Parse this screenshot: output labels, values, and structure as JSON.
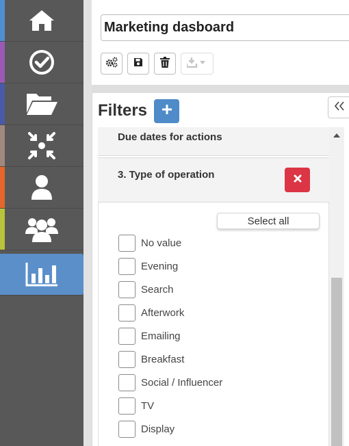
{
  "sidebar": {
    "items": [
      {
        "name": "home",
        "icon": "home-icon",
        "stripe_color": "#4f8fd0"
      },
      {
        "name": "actions",
        "icon": "check-circle-icon",
        "stripe_color": "#9b59b6"
      },
      {
        "name": "files",
        "icon": "folder-open-icon",
        "stripe_color": "#4a5aa8"
      },
      {
        "name": "compress",
        "icon": "compress-icon",
        "stripe_color": "#a1887f"
      },
      {
        "name": "user",
        "icon": "user-icon",
        "stripe_color": "#e5662a"
      },
      {
        "name": "users",
        "icon": "users-icon",
        "stripe_color": "#b8c43a"
      },
      {
        "name": "dashboard",
        "icon": "bar-chart-icon",
        "stripe_color": "#5b8fc9",
        "active": true
      }
    ],
    "active_color": "#5b8fc9"
  },
  "dashboard": {
    "title_value": "Marketing dasboard",
    "toolbar": {
      "settings_icon": "cogs-icon",
      "save_icon": "save-icon",
      "delete_icon": "trash-icon",
      "export_icon": "download-icon"
    }
  },
  "filters": {
    "heading": "Filters",
    "add_icon": "plus-icon",
    "collapse_icon": "double-chevron-left-icon",
    "sections": {
      "due_dates_label": "Due dates for actions",
      "type_label": "3. Type of operation"
    },
    "select_all_label": "Select all",
    "options": [
      "No value",
      "Evening",
      "Search",
      "Afterwork",
      "Emailing",
      "Breakfast",
      "Social / Influencer",
      "TV",
      "Display"
    ],
    "remove_color": "#dc3545",
    "add_color": "#4e8bc8"
  }
}
